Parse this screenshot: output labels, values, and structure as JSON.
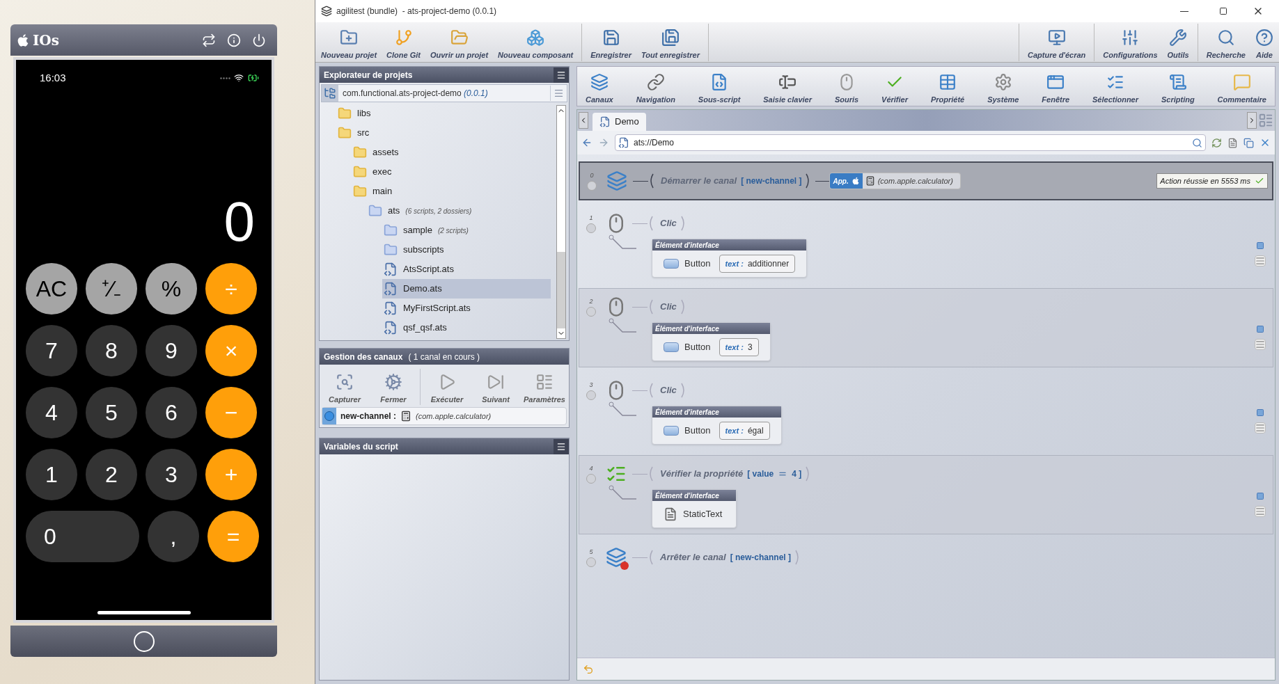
{
  "phone": {
    "title": "IOs",
    "time": "16:03",
    "display": "0",
    "keys": [
      {
        "label": "AC",
        "kind": "func"
      },
      {
        "label": "⁺∕₋",
        "kind": "func"
      },
      {
        "label": "%",
        "kind": "func"
      },
      {
        "label": "÷",
        "kind": "op"
      },
      {
        "label": "7",
        "kind": "digit"
      },
      {
        "label": "8",
        "kind": "digit"
      },
      {
        "label": "9",
        "kind": "digit"
      },
      {
        "label": "×",
        "kind": "op"
      },
      {
        "label": "4",
        "kind": "digit"
      },
      {
        "label": "5",
        "kind": "digit"
      },
      {
        "label": "6",
        "kind": "digit"
      },
      {
        "label": "−",
        "kind": "op"
      },
      {
        "label": "1",
        "kind": "digit"
      },
      {
        "label": "2",
        "kind": "digit"
      },
      {
        "label": "3",
        "kind": "digit"
      },
      {
        "label": "+",
        "kind": "op"
      },
      {
        "label": "0",
        "kind": "wide"
      },
      {
        "label": ",",
        "kind": "digit"
      },
      {
        "label": "=",
        "kind": "op"
      }
    ]
  },
  "window": {
    "title": "agilitest (bundle)  - ats-project-demo (0.0.1)"
  },
  "main_toolbar": {
    "left": [
      [
        "Nouveau projet",
        "Clone Git",
        "Ouvrir un projet",
        "Nouveau composant"
      ],
      [
        "Enregistrer",
        "Tout enregistrer"
      ]
    ],
    "right": [
      [
        "Capture d'écran"
      ],
      [
        "Configurations",
        "Outils"
      ],
      [
        "Recherche",
        "Aide"
      ]
    ]
  },
  "explorer": {
    "title": "Explorateur de projets",
    "project": "com.functional.ats-project-demo",
    "version": "(0.0.1)",
    "tree": [
      {
        "label": "libs",
        "kind": "folder",
        "selected": false
      },
      {
        "label": "src",
        "kind": "folder",
        "selected": false,
        "children": [
          {
            "label": "assets",
            "kind": "folder",
            "selected": false
          },
          {
            "label": "exec",
            "kind": "folder",
            "selected": false
          },
          {
            "label": "main",
            "kind": "folder",
            "selected": false,
            "children": [
              {
                "label": "ats",
                "note": "(6 scripts, 2 dossiers)",
                "kind": "package",
                "selected": false,
                "children": [
                  {
                    "label": "sample",
                    "note": "(2 scripts)",
                    "kind": "package",
                    "selected": false
                  },
                  {
                    "label": "subscripts",
                    "kind": "package",
                    "selected": false
                  },
                  {
                    "label": "AtsScript.ats",
                    "kind": "script",
                    "selected": false
                  },
                  {
                    "label": "Demo.ats",
                    "kind": "script",
                    "selected": true
                  },
                  {
                    "label": "MyFirstScript.ats",
                    "kind": "script",
                    "selected": false
                  },
                  {
                    "label": "qsf_qsf.ats",
                    "kind": "script",
                    "selected": false
                  }
                ]
              }
            ]
          }
        ]
      }
    ]
  },
  "channels": {
    "title": "Gestion des canaux",
    "status": "( 1 canal en cours )",
    "tools": [
      [
        "Capturer",
        "Fermer"
      ],
      [
        "Exécuter",
        "Suivant",
        "Paramètres"
      ]
    ],
    "channel": {
      "name": "new-channel :",
      "app": "(com.apple.calculator)"
    }
  },
  "variables": {
    "title": "Variables du script"
  },
  "actions_toolbar": [
    "Canaux",
    "Navigation",
    "Sous-script",
    "Saisie clavier",
    "Souris",
    "Vérifier",
    "Propriété",
    "Système",
    "Fenêtre",
    "Sélectionner",
    "Scripting",
    "Commentaire"
  ],
  "tabs": [
    {
      "label": "Demo",
      "selected": true
    }
  ],
  "address": "ats://Demo",
  "script": [
    {
      "index": "0",
      "kind": "start",
      "title": "Démarrer le canal",
      "params": [
        "[ new-channel ]"
      ],
      "app": {
        "badge": "App.",
        "target": "(com.apple.calculator)"
      },
      "result": "Action réussie en 5553 ms",
      "selected": true
    },
    {
      "index": "1",
      "kind": "click",
      "title": "Clic",
      "selected": false,
      "element": {
        "header": "Élément d'interface",
        "kind": "button",
        "tag": "Button",
        "key": "text :",
        "value": "additionner"
      }
    },
    {
      "index": "2",
      "kind": "click",
      "title": "Clic",
      "selected": false,
      "element": {
        "header": "Élément d'interface",
        "kind": "button",
        "tag": "Button",
        "key": "text :",
        "value": "3"
      }
    },
    {
      "index": "3",
      "kind": "click",
      "title": "Clic",
      "selected": false,
      "element": {
        "header": "Élément d'interface",
        "kind": "button",
        "tag": "Button",
        "key": "text :",
        "value": "égal"
      }
    },
    {
      "index": "4",
      "kind": "verify",
      "title": "Vérifier la propriété",
      "params": [
        "[ value",
        "4 ]"
      ],
      "selected": false,
      "element": {
        "header": "Élément d'interface",
        "kind": "text",
        "tag": "StaticText"
      }
    },
    {
      "index": "5",
      "kind": "stop",
      "title": "Arrêter le canal",
      "params": [
        "[ new-channel ]"
      ],
      "selected": false
    }
  ]
}
